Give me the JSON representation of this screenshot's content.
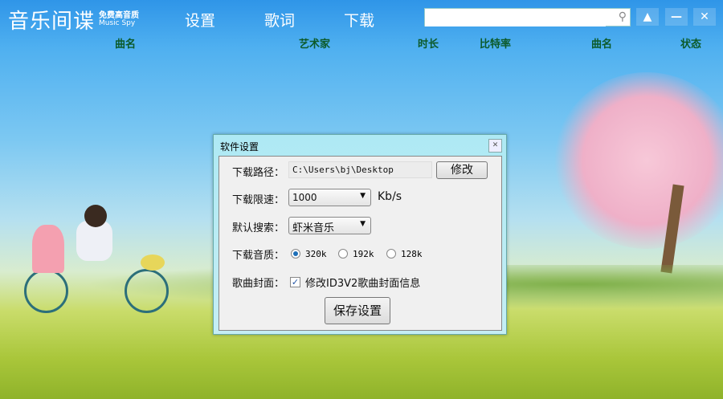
{
  "app": {
    "title": "音乐间谍",
    "tagline": "免费高音质",
    "subtitle": "Music Spy"
  },
  "nav": [
    {
      "label": "设置"
    },
    {
      "label": "歌词"
    },
    {
      "label": "下载"
    }
  ],
  "search": {
    "value": "",
    "placeholder": ""
  },
  "columns": [
    "曲名",
    "艺术家",
    "时长",
    "比特率",
    "曲名",
    "状态"
  ],
  "dialog": {
    "title": "软件设置",
    "path_label": "下载路径：",
    "path_value": "C:\\Users\\bj\\Desktop",
    "modify_label": "修改",
    "speed_label": "下载限速：",
    "speed_value": "1000",
    "speed_unit": "Kb/s",
    "search_label": "默认搜索：",
    "search_value": "虾米音乐",
    "quality_label": "下载音质：",
    "quality_options": [
      "320k",
      "192k",
      "128k"
    ],
    "quality_selected": "320k",
    "cover_label": "歌曲封面：",
    "cover_option": "修改ID3V2歌曲封面信息",
    "cover_checked": true,
    "save_label": "保存设置"
  }
}
